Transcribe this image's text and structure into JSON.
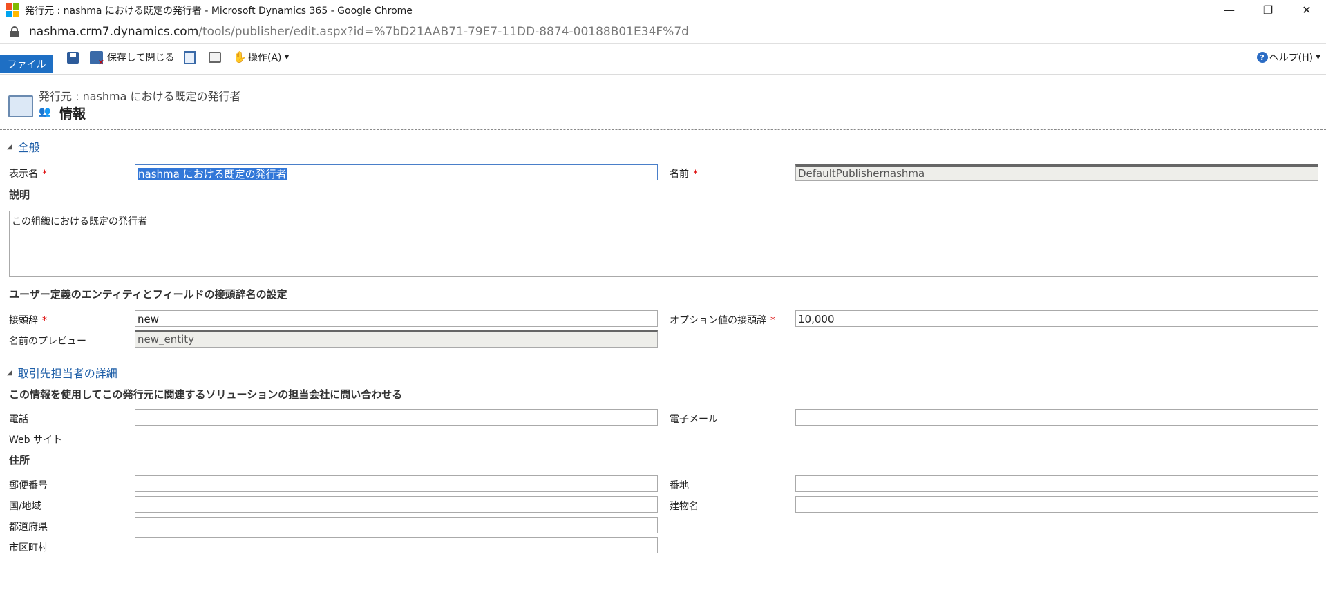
{
  "window": {
    "title": "発行元 : nashma における既定の発行者 - Microsoft Dynamics 365 - Google Chrome",
    "minimize": "—",
    "restore": "❐",
    "close": "✕"
  },
  "address": {
    "host": "nashma.crm7.dynamics.com",
    "path": "/tools/publisher/edit.aspx?id=%7bD21AAB71-79E7-11DD-8874-00188B01E34F%7d"
  },
  "ribbon": {
    "file_tab": "ファイル",
    "save_close": "保存して閉じる",
    "actions": "操作(A)",
    "help": "ヘルプ(H)"
  },
  "header": {
    "subtitle": "発行元 : nashma における既定の発行者",
    "title": "情報"
  },
  "general": {
    "section_title": "全般",
    "display_name_label": "表示名",
    "display_name_value": "nashma における既定の発行者",
    "name_label": "名前",
    "name_value": "DefaultPublishernashma",
    "description_label": "説明",
    "description_value": "この組織における既定の発行者",
    "prefix_heading": "ユーザー定義のエンティティとフィールドの接頭辞名の設定",
    "prefix_label": "接頭辞",
    "prefix_value": "new",
    "option_prefix_label": "オプション値の接頭辞",
    "option_prefix_value": "10,000",
    "name_preview_label": "名前のプレビュー",
    "name_preview_value": "new_entity"
  },
  "contact": {
    "section_title": "取引先担当者の詳細",
    "intro": "この情報を使用してこの発行元に関連するソリューションの担当会社に問い合わせる",
    "phone_label": "電話",
    "email_label": "電子メール",
    "website_label": "Web サイト",
    "address_heading": "住所",
    "postal_label": "郵便番号",
    "street_label": "番地",
    "country_label": "国/地域",
    "building_label": "建物名",
    "state_label": "都道府県",
    "city_label": "市区町村"
  },
  "required_mark": "*"
}
